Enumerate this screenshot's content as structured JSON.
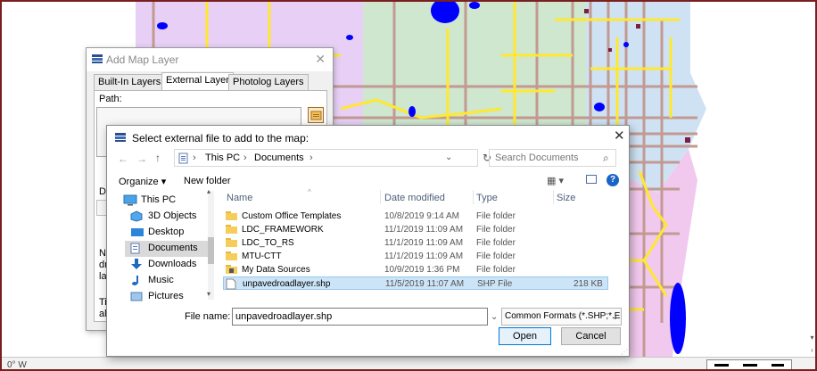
{
  "map": {
    "colors": {
      "purple": "#e7cff6",
      "green": "#cfe6cf",
      "blue": "#cfe2f4",
      "pink": "#f2c9ee",
      "yellow_road": "#ffe82f",
      "brown_road": "#c29a92",
      "water": "#0000ff"
    },
    "status": {
      "coordinate_text": "0° W"
    },
    "icons": {
      "scroll_down": "chevron-down-icon",
      "scroll_right": "chevron-right-icon"
    }
  },
  "add_layer": {
    "title": "Add Map Layer",
    "close": "✕",
    "tabs": [
      "Built-In Layers",
      "External Layer",
      "Photolog Layers"
    ],
    "active_tab": "External Layer",
    "path_label": "Path:",
    "display_label": "Disp",
    "note_lines": [
      "Note",
      "drag",
      "layer"
    ],
    "tip_lines": [
      "Tip: I",
      "allow"
    ]
  },
  "file_dialog": {
    "title": "Select external file to add to the map:",
    "close": "✕",
    "nav": {
      "back": "←",
      "forward": "→",
      "up": "↑",
      "refresh": "↻",
      "address_dropdown": "⌄"
    },
    "breadcrumb": [
      "This PC",
      "Documents"
    ],
    "breadcrumb_sep": "›",
    "search_placeholder": "Search Documents",
    "search_icon": "⌕",
    "toolbar": {
      "organize": "Organize ▾",
      "new_folder": "New folder",
      "view_icon": "▦ ▾",
      "help_icon": "?"
    },
    "nav_pane": [
      {
        "label": "This PC",
        "icon": "computer-icon"
      },
      {
        "label": "3D Objects",
        "icon": "cube-icon"
      },
      {
        "label": "Desktop",
        "icon": "desktop-icon"
      },
      {
        "label": "Documents",
        "icon": "documents-icon",
        "selected": true
      },
      {
        "label": "Downloads",
        "icon": "download-icon"
      },
      {
        "label": "Music",
        "icon": "music-icon"
      },
      {
        "label": "Pictures",
        "icon": "pictures-icon"
      }
    ],
    "columns": [
      "Name",
      "Date modified",
      "Type",
      "Size"
    ],
    "files": [
      {
        "name": "Custom Office Templates",
        "date": "10/8/2019 9:14 AM",
        "type": "File folder",
        "size": "",
        "icon": "folder-icon"
      },
      {
        "name": "LDC_FRAMEWORK",
        "date": "11/1/2019 11:09 AM",
        "type": "File folder",
        "size": "",
        "icon": "folder-icon"
      },
      {
        "name": "LDC_TO_RS",
        "date": "11/1/2019 11:09 AM",
        "type": "File folder",
        "size": "",
        "icon": "folder-icon"
      },
      {
        "name": "MTU-CTT",
        "date": "11/1/2019 11:09 AM",
        "type": "File folder",
        "size": "",
        "icon": "folder-icon"
      },
      {
        "name": "My Data Sources",
        "date": "10/9/2019 1:36 PM",
        "type": "File folder",
        "size": "",
        "icon": "data-sources-folder-icon"
      },
      {
        "name": "unpavedroadlayer.shp",
        "date": "11/5/2019 11:07 AM",
        "type": "SHP File",
        "size": "218 KB",
        "icon": "file-icon",
        "selected": true
      }
    ],
    "file_name_label": "File name:",
    "file_name_value": "unpavedroadlayer.shp",
    "file_type": "Common Formats (*.SHP;*.ECW",
    "open_label": "Open",
    "cancel_label": "Cancel"
  }
}
